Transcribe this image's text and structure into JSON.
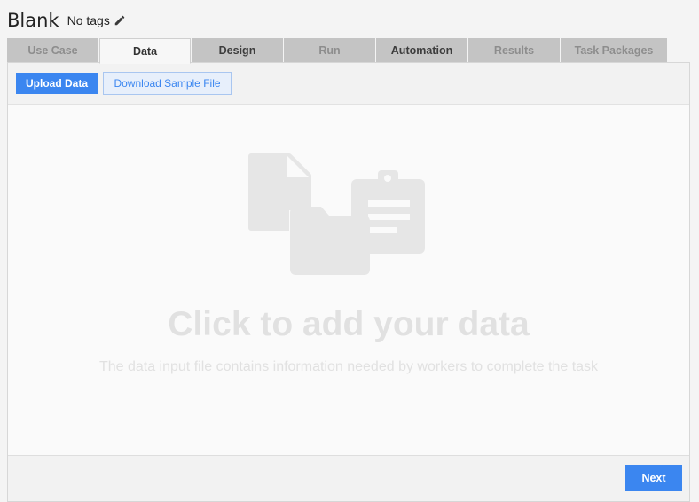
{
  "header": {
    "title": "Blank",
    "tags": "No tags"
  },
  "tabs": [
    {
      "label": "Use Case",
      "state": "disabled"
    },
    {
      "label": "Data",
      "state": "active"
    },
    {
      "label": "Design",
      "state": "enabled"
    },
    {
      "label": "Run",
      "state": "disabled"
    },
    {
      "label": "Automation",
      "state": "enabled"
    },
    {
      "label": "Results",
      "state": "disabled"
    },
    {
      "label": "Task Packages",
      "state": "disabled"
    }
  ],
  "toolbar": {
    "upload_label": "Upload Data",
    "download_label": "Download Sample File"
  },
  "dropzone": {
    "title": "Click to add your data",
    "subtitle": "The data input file contains information needed by workers to complete the task"
  },
  "footer": {
    "next_label": "Next"
  },
  "colors": {
    "accent": "#3b86f0",
    "placeholder_text": "#e1e1e1",
    "illustration": "#e6e6e6"
  },
  "icons": [
    "pencil-icon",
    "document-icon",
    "folder-icon",
    "clipboard-icon"
  ]
}
